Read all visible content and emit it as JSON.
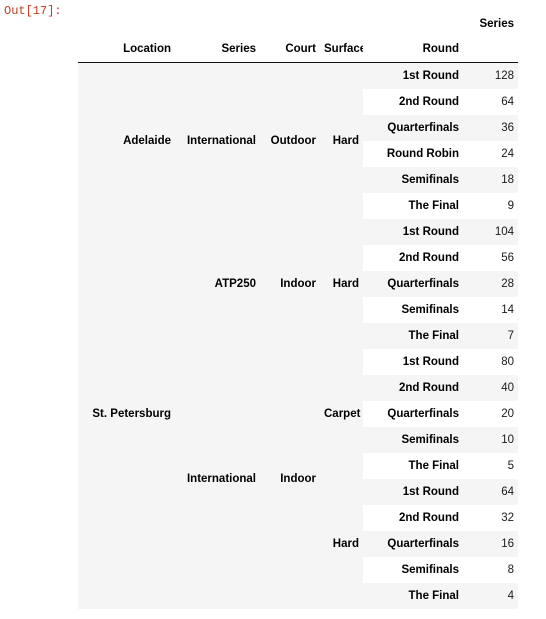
{
  "notebook": {
    "prompt": "Out[17]:"
  },
  "table": {
    "value_column_header": "Series",
    "index_headers": [
      "Location",
      "Series",
      "Court",
      "Surface",
      "Round"
    ],
    "rows": [
      {
        "location": "Adelaide",
        "series": "International",
        "court": "Outdoor",
        "surface": "Hard",
        "round": "1st Round",
        "value": "128"
      },
      {
        "location": "",
        "series": "",
        "court": "",
        "surface": "",
        "round": "2nd Round",
        "value": "64"
      },
      {
        "location": "",
        "series": "",
        "court": "",
        "surface": "",
        "round": "Quarterfinals",
        "value": "36"
      },
      {
        "location": "",
        "series": "",
        "court": "",
        "surface": "",
        "round": "Round Robin",
        "value": "24"
      },
      {
        "location": "",
        "series": "",
        "court": "",
        "surface": "",
        "round": "Semifinals",
        "value": "18"
      },
      {
        "location": "",
        "series": "",
        "court": "",
        "surface": "",
        "round": "The Final",
        "value": "9"
      },
      {
        "location": "St. Petersburg",
        "series": "ATP250",
        "court": "Indoor",
        "surface": "Hard",
        "round": "1st Round",
        "value": "104"
      },
      {
        "location": "",
        "series": "",
        "court": "",
        "surface": "",
        "round": "2nd Round",
        "value": "56"
      },
      {
        "location": "",
        "series": "",
        "court": "",
        "surface": "",
        "round": "Quarterfinals",
        "value": "28"
      },
      {
        "location": "",
        "series": "",
        "court": "",
        "surface": "",
        "round": "Semifinals",
        "value": "14"
      },
      {
        "location": "",
        "series": "",
        "court": "",
        "surface": "",
        "round": "The Final",
        "value": "7"
      },
      {
        "location": "",
        "series": "International",
        "court": "Indoor",
        "surface": "Carpet",
        "round": "1st Round",
        "value": "80"
      },
      {
        "location": "",
        "series": "",
        "court": "",
        "surface": "",
        "round": "2nd Round",
        "value": "40"
      },
      {
        "location": "",
        "series": "",
        "court": "",
        "surface": "",
        "round": "Quarterfinals",
        "value": "20"
      },
      {
        "location": "",
        "series": "",
        "court": "",
        "surface": "",
        "round": "Semifinals",
        "value": "10"
      },
      {
        "location": "",
        "series": "",
        "court": "",
        "surface": "",
        "round": "The Final",
        "value": "5"
      },
      {
        "location": "",
        "series": "",
        "court": "",
        "surface": "Hard",
        "round": "1st Round",
        "value": "64"
      },
      {
        "location": "",
        "series": "",
        "court": "",
        "surface": "",
        "round": "2nd Round",
        "value": "32"
      },
      {
        "location": "",
        "series": "",
        "court": "",
        "surface": "",
        "round": "Quarterfinals",
        "value": "16"
      },
      {
        "location": "",
        "series": "",
        "court": "",
        "surface": "",
        "round": "Semifinals",
        "value": "8"
      },
      {
        "location": "",
        "series": "",
        "court": "",
        "surface": "",
        "round": "The Final",
        "value": "4"
      }
    ],
    "groups": {
      "location": [
        {
          "label": "Adelaide",
          "span": 6
        },
        {
          "label": "St. Petersburg",
          "span": 15
        }
      ],
      "series": [
        {
          "label": "International",
          "span": 6
        },
        {
          "label": "ATP250",
          "span": 5
        },
        {
          "label": "International",
          "span": 10
        }
      ],
      "court": [
        {
          "label": "Outdoor",
          "span": 6
        },
        {
          "label": "Indoor",
          "span": 5
        },
        {
          "label": "Indoor",
          "span": 10
        }
      ],
      "surface": [
        {
          "label": "Hard",
          "span": 6
        },
        {
          "label": "Hard",
          "span": 5
        },
        {
          "label": "Carpet",
          "span": 5
        },
        {
          "label": "Hard",
          "span": 5
        }
      ]
    },
    "colors": {
      "shade": "#f5f5f5",
      "rule": "#111111",
      "prompt": "#bf3f22"
    }
  }
}
